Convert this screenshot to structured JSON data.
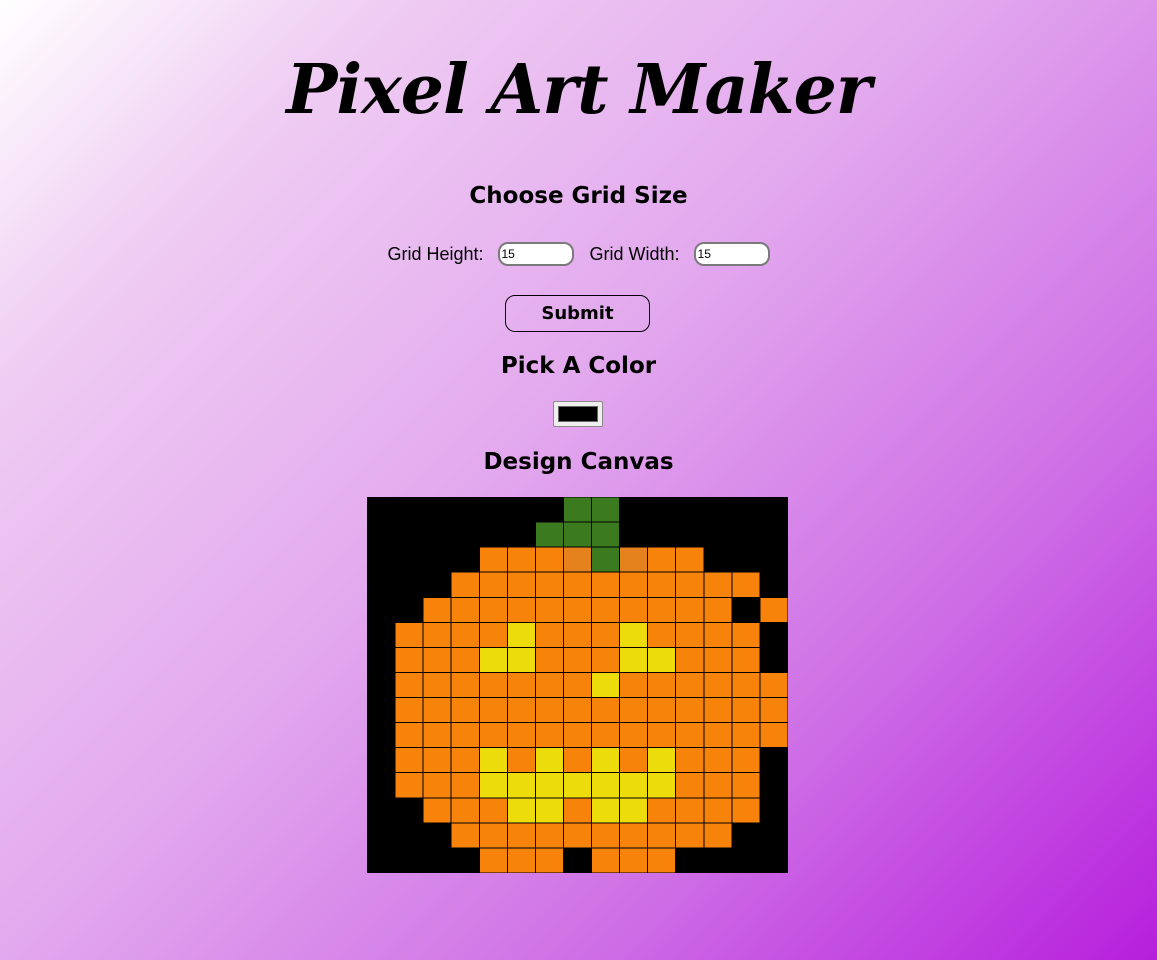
{
  "title": "Pixel Art Maker",
  "grid_size": {
    "heading": "Choose Grid Size",
    "height_label": "Grid Height:",
    "height_value": "15",
    "width_label": "Grid Width:",
    "width_value": "15"
  },
  "submit_label": "Submit",
  "color": {
    "heading": "Pick A Color",
    "value": "#000000"
  },
  "canvas": {
    "heading": "Design Canvas",
    "rows": 15,
    "cols": 15,
    "palette": {
      "k": "#000000",
      "g": "#3b7a1f",
      "o": "#f7830a",
      "d": "#e6821e",
      "y": "#eddc0c"
    },
    "grid": [
      "kkkkkkkggkkkkkk",
      "kkkkkkgggkkkkkk",
      "kkkkooodgdookkk",
      "kkkoooooooooook",
      "kkoooooooooooko",
      "kooooyoooyooook",
      "koooyyoooyyoook",
      "koooooooyooooook",
      "kooooooooooooook",
      "kooooooooooooook",
      "koooyoyoyoyoook",
      "koooyyyyyyyoook",
      "kkoooyyoyyooookk",
      "kkkooooooooookkk",
      "kkkkoookoookkkkk"
    ]
  }
}
